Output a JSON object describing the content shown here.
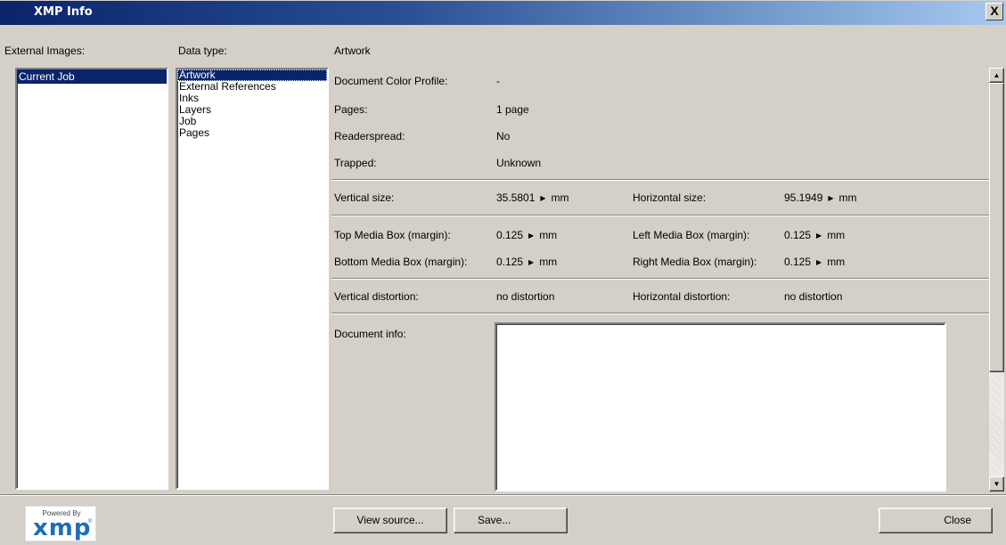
{
  "window": {
    "title": "XMP Info",
    "close_glyph": "X"
  },
  "external_images": {
    "label": "External Images:",
    "items": [
      "Current Job"
    ],
    "selected": "Current Job"
  },
  "data_type": {
    "label": "Data type:",
    "items": [
      "Artwork",
      "External References",
      "Inks",
      "Layers",
      "Job",
      "Pages"
    ],
    "selected": "Artwork"
  },
  "details": {
    "heading": "Artwork",
    "document_color_profile": {
      "label": "Document Color Profile:",
      "value": "-"
    },
    "pages": {
      "label": "Pages:",
      "value": "1 page"
    },
    "readerspread": {
      "label": "Readerspread:",
      "value": "No"
    },
    "trapped": {
      "label": "Trapped:",
      "value": "Unknown"
    },
    "vertical_size": {
      "label": "Vertical size:",
      "value": "35.5801",
      "unit": "mm"
    },
    "horizontal_size": {
      "label": "Horizontal size:",
      "value": "95.1949",
      "unit": "mm"
    },
    "top_media_box": {
      "label": "Top Media Box (margin):",
      "value": "0.125",
      "unit": "mm"
    },
    "left_media_box": {
      "label": "Left Media Box (margin):",
      "value": "0.125",
      "unit": "mm"
    },
    "bottom_media_box": {
      "label": "Bottom Media Box (margin):",
      "value": "0.125",
      "unit": "mm"
    },
    "right_media_box": {
      "label": "Right Media Box (margin):",
      "value": "0.125",
      "unit": "mm"
    },
    "vertical_distortion": {
      "label": "Vertical distortion:",
      "value": "no distortion"
    },
    "horizontal_distortion": {
      "label": "Horizontal distortion:",
      "value": "no distortion"
    },
    "document_info": {
      "label": "Document info:",
      "value": ""
    }
  },
  "icons": {
    "unit_arrow": "right-triangle-icon",
    "scroll_up": "arrow-up-icon",
    "scroll_down": "arrow-down-icon"
  },
  "buttons": {
    "view_source": "View source...",
    "save": "Save...",
    "close": "Close"
  },
  "logo": {
    "powered_by": "Powered By",
    "brand": "xmp",
    "tm": "®"
  },
  "colors": {
    "title_start": "#0a246a",
    "title_end": "#a6caf0",
    "selection": "#0a246a",
    "logo_blue": "#1f6fb4",
    "face": "#d4d0c8"
  }
}
